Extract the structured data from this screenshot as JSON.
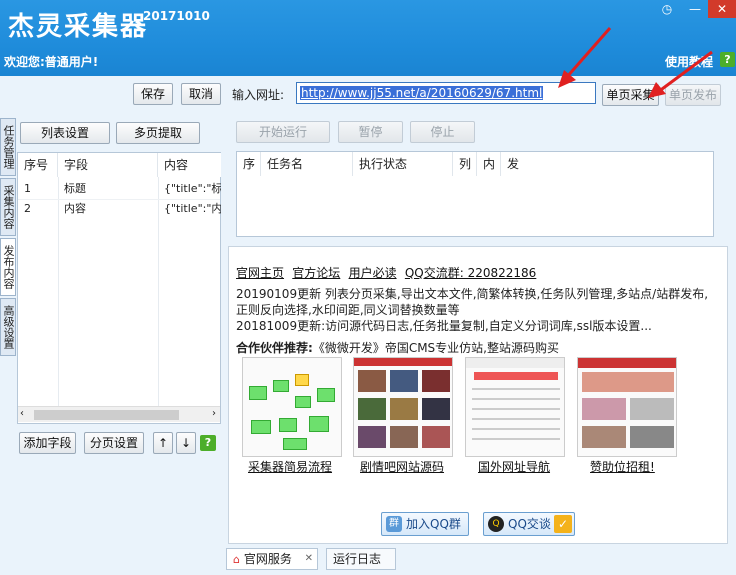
{
  "header": {
    "title": "杰灵采集器",
    "version": "20171010",
    "welcome": "欢迎您:普通用户!",
    "help_label": "使用教程",
    "help_icon": "question-icon"
  },
  "toolbar": {
    "save_label": "保存",
    "cancel_label": "取消",
    "url_label": "输入网址:",
    "url_value": "http://www.jj55.net/a/20160629/67.html",
    "single_collect_label": "单页采集",
    "single_publish_label": "单页发布"
  },
  "left_tabs": [
    "任务管理",
    "采集内容",
    "发布内容",
    "高级设置"
  ],
  "left_panel": {
    "list_settings_label": "列表设置",
    "multipage_label": "多页提取",
    "columns": [
      "序号",
      "字段",
      "内容"
    ],
    "rows": [
      {
        "no": "1",
        "field": "标题",
        "content": "{\"title\":\"标题"
      },
      {
        "no": "2",
        "field": "内容",
        "content": "{\"title\":\"内容"
      }
    ],
    "add_field_label": "添加字段",
    "paging_label": "分页设置",
    "up_label": "↑",
    "down_label": "↓",
    "help_label": "?"
  },
  "task_panel": {
    "start_label": "开始运行",
    "pause_label": "暂停",
    "stop_label": "停止",
    "columns": [
      "序",
      "任务名",
      "执行状态",
      "列",
      "内",
      "发"
    ]
  },
  "web_panel": {
    "links": [
      "官网主页",
      "官方论坛",
      "用户必读",
      "QQ交流群: 220822186"
    ],
    "news": [
      "20190109更新 列表分页采集,导出文本文件,简繁体转换,任务队列管理,多站点/站群发布,正则反向选择,水印间距,同义词替换数量等",
      "20181009更新:访问源代码日志,任务批量复制,自定义分词词库,ssl版本设置..."
    ],
    "partner_label": "合作伙伴推荐:",
    "partner_text": "《微微开发》帝国CMS专业仿站,整站源码购买",
    "thumbs": [
      "采集器简易流程",
      "剧情吧网站源码",
      "国外网址导航",
      "赞助位招租!"
    ],
    "qq_group_label": "加入QQ群",
    "qq_chat_label": "QQ交谈"
  },
  "bottom_tabs": {
    "service_label": "官网服务",
    "close_label": "✕",
    "log_label": "运行日志"
  }
}
